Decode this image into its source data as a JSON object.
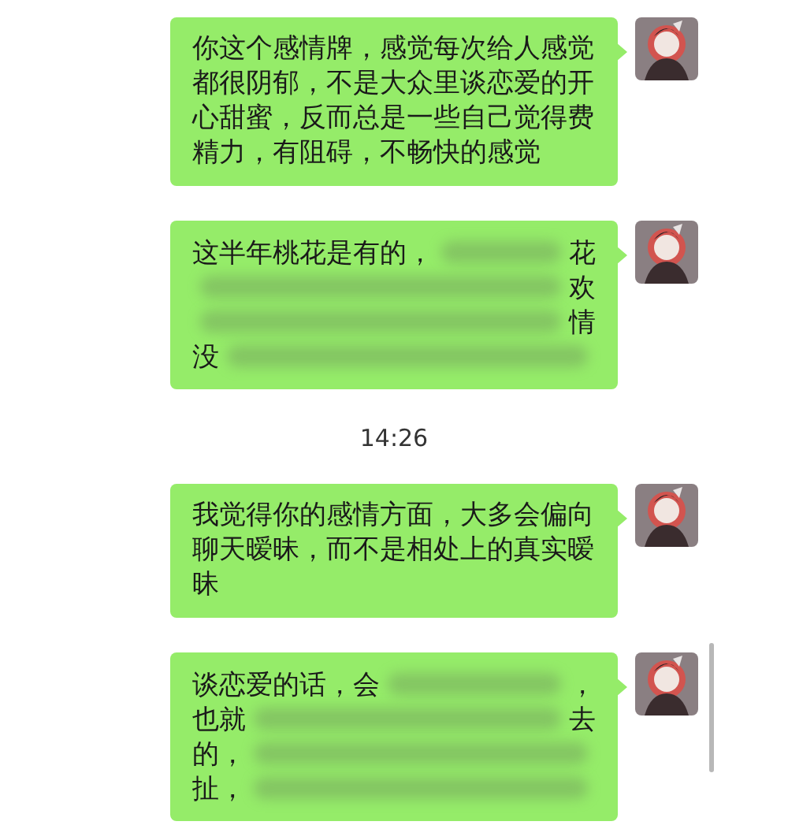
{
  "messages": [
    {
      "kind": "message",
      "lines": [
        [
          {
            "kind": "text",
            "text": "你这个感情牌，感觉每次给人感觉都很阴郁，不是大众里谈恋爱的开心甜蜜，反而总是一些自己觉得费精力，有阻碍，不畅快的感觉"
          }
        ]
      ]
    },
    {
      "kind": "message",
      "lines": [
        [
          {
            "kind": "text",
            "text": "这半年桃花是有的，"
          },
          {
            "kind": "blur"
          },
          {
            "kind": "text",
            "text": "花"
          }
        ],
        [
          {
            "kind": "blur"
          },
          {
            "kind": "text",
            "text": "欢"
          }
        ],
        [
          {
            "kind": "blur"
          },
          {
            "kind": "text",
            "text": "情"
          }
        ],
        [
          {
            "kind": "text",
            "text": "没"
          },
          {
            "kind": "blur"
          }
        ]
      ]
    },
    {
      "kind": "time",
      "text": "14:26"
    },
    {
      "kind": "message",
      "lines": [
        [
          {
            "kind": "text",
            "text": "我觉得你的感情方面，大多会偏向聊天暧昧，而不是相处上的真实暧昧"
          }
        ]
      ]
    },
    {
      "kind": "message",
      "lines": [
        [
          {
            "kind": "text",
            "text": "谈恋爱的话，会"
          },
          {
            "kind": "blur"
          },
          {
            "kind": "text",
            "text": "，"
          }
        ],
        [
          {
            "kind": "text",
            "text": "也就"
          },
          {
            "kind": "blur"
          },
          {
            "kind": "text",
            "text": "去"
          }
        ],
        [
          {
            "kind": "text",
            "text": "的，"
          },
          {
            "kind": "blur"
          }
        ],
        [
          {
            "kind": "text",
            "text": "扯，"
          },
          {
            "kind": "blur"
          }
        ]
      ]
    }
  ]
}
